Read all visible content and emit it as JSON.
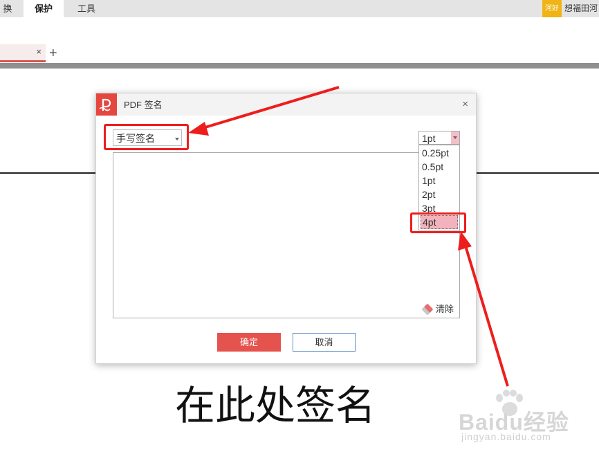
{
  "ribbon": {
    "tabs": [
      {
        "label": "换",
        "active": false
      },
      {
        "label": "保护",
        "active": true
      },
      {
        "label": "工具",
        "active": false
      }
    ],
    "user_badge": "河好",
    "user_name": "想福田河"
  },
  "doc_tabs": {
    "close_glyph": "×",
    "new_tab_glyph": "+"
  },
  "dialog": {
    "title": "PDF 签名",
    "close_glyph": "×",
    "signature_mode": {
      "selected": "手写签名"
    },
    "stroke_width": {
      "selected": "1pt",
      "options": [
        "0.25pt",
        "0.5pt",
        "1pt",
        "2pt",
        "3pt",
        "4pt"
      ],
      "highlighted": "4pt"
    },
    "clear_label": "清除",
    "ok_label": "确定",
    "cancel_label": "取消"
  },
  "document": {
    "caption": "在此处签名"
  },
  "watermark": {
    "brand": "Baidu经验",
    "url": "jingyan.baidu.com"
  },
  "colors": {
    "accent": "#e5473f",
    "annotation": "#ee1d1d",
    "highlight": "#f3b3bd",
    "cancel_border": "#5b8cc9"
  }
}
